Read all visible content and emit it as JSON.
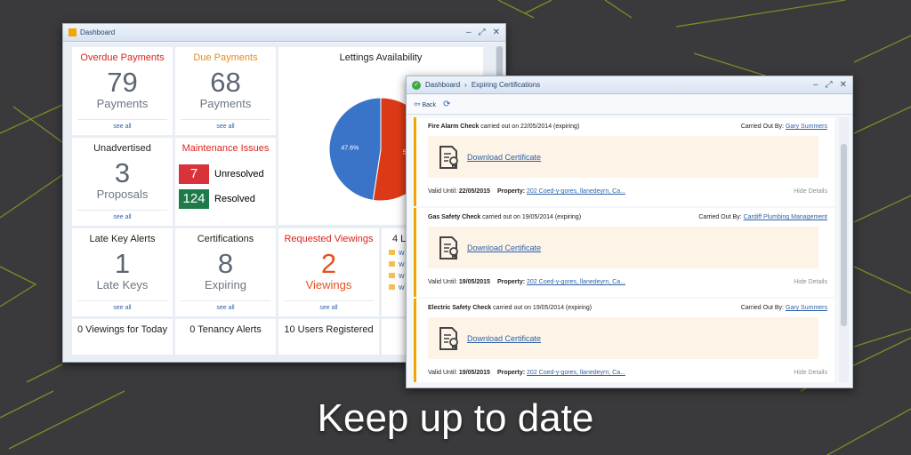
{
  "dashboard": {
    "title": "Dashboard",
    "tiles": {
      "overdue": {
        "title": "Overdue Payments",
        "count": "79",
        "unit": "Payments",
        "link": "see all"
      },
      "due": {
        "title": "Due Payments",
        "count": "68",
        "unit": "Payments",
        "link": "see all"
      },
      "lettings": {
        "title": "Lettings Availability",
        "slices": [
          {
            "label": "52.4%",
            "value": 52.4,
            "color": "#dc3a16"
          },
          {
            "label": "47.6%",
            "value": 47.6,
            "color": "#3a74c8"
          }
        ]
      },
      "unadvertised": {
        "title": "Unadvertised",
        "count": "3",
        "unit": "Proposals",
        "link": "see all"
      },
      "maintenance": {
        "title": "Maintenance Issues",
        "unresolved_count": "7",
        "unresolved_label": "Unresolved",
        "resolved_count": "124",
        "resolved_label": "Resolved"
      },
      "late_keys": {
        "title": "Late Key Alerts",
        "count": "1",
        "unit": "Late Keys",
        "link": "see all"
      },
      "certifications": {
        "title": "Certifications",
        "count": "8",
        "unit": "Expiring",
        "link": "see all"
      },
      "viewings": {
        "title": "Requested Viewings",
        "count": "2",
        "unit": "Viewings",
        "link": "see all"
      },
      "partial": {
        "title": "4 L",
        "items": [
          "W",
          "W",
          "W",
          "W"
        ]
      },
      "today": {
        "title": "0 Viewings for Today"
      },
      "tenancy": {
        "title": "0 Tenancy Alerts"
      },
      "users": {
        "title": "10 Users Registered"
      }
    }
  },
  "certs_window": {
    "breadcrumb_root": "Dashboard",
    "breadcrumb_sep": "›",
    "breadcrumb_current": "Expiring Certifications",
    "back_label": "Back",
    "carried_prefix": "carried out on",
    "carried_by_label": "Carried Out By:",
    "valid_label": "Valid Until:",
    "property_label": "Property:",
    "download_label": "Download Certificate",
    "hide_label": "Hide Details",
    "items": [
      {
        "name": "Fire Alarm Check",
        "date": "22/05/2014 (expiring)",
        "by": "Gary Summers",
        "valid": "22/05/2015",
        "property": "202 Coed-y-gores, llanedeyrn, Ca..."
      },
      {
        "name": "Gas Safety Check",
        "date": "19/05/2014 (expiring)",
        "by": "Cardiff Plumbing Management",
        "valid": "19/05/2015",
        "property": "202 Coed-y-gores, llanedeyrn, Ca..."
      },
      {
        "name": "Electric Safety Check",
        "date": "19/05/2014 (expiring)",
        "by": "Gary Summers",
        "valid": "19/05/2015",
        "property": "202 Coed-y-gores, llanedeyrn, Ca..."
      }
    ]
  },
  "caption": "Keep up to date"
}
